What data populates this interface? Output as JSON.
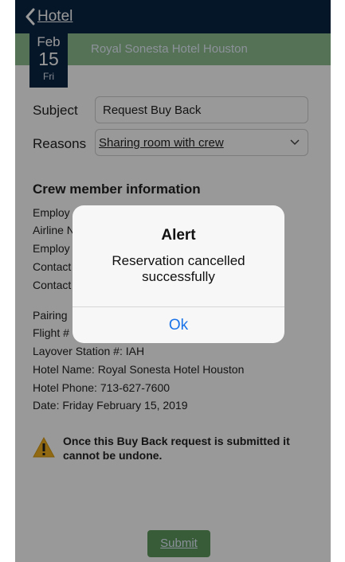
{
  "nav": {
    "back_label": "Hotel"
  },
  "header": {
    "hotel_name": "Royal Sonesta Hotel Houston",
    "date": {
      "month": "Feb",
      "day": "15",
      "weekday": "Fri"
    }
  },
  "form": {
    "subject_label": "Subject",
    "subject_value": "Request Buy Back",
    "reasons_label": "Reasons",
    "reasons_value": "Sharing room with crew"
  },
  "crew_info": {
    "title": "Crew member information",
    "lines": [
      "Employ",
      "Airline N",
      "Employ",
      "Contact",
      "Contact",
      "Pairing",
      "Flight #",
      "Layover Station #: IAH",
      "Hotel Name: Royal Sonesta Hotel Houston",
      "Hotel Phone: 713-627-7600",
      "Date:  Friday February 15, 2019"
    ]
  },
  "warning": {
    "text": "Once this Buy Back request is submitted it cannot be undone."
  },
  "submit_label": "Submit",
  "alert": {
    "title": "Alert",
    "message": "Reservation cancelled successfully",
    "ok_label": "Ok"
  },
  "colors": {
    "nav": "#0b2545",
    "band": "#8fbf8f",
    "submit": "#5c9a5c",
    "ok_text": "#1a73e8"
  }
}
